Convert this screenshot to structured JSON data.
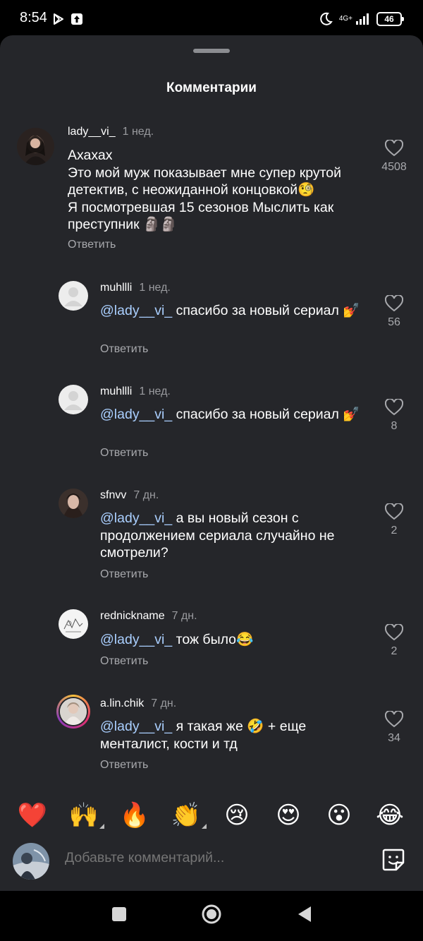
{
  "status_bar": {
    "time": "8:54",
    "network": "4G+",
    "battery": "46"
  },
  "sheet": {
    "title": "Комментарии"
  },
  "comments": [
    {
      "username": "lady__vi_",
      "time": "1 нед.",
      "mention": "",
      "text": "Ахахах\nЭто мой муж показывает мне супер крутой детектив, с неожиданной концовкой🧐\nЯ посмотревшая 15 сезонов Мыслить как преступник 🗿🗿",
      "reply": "Ответить",
      "likes": "4508"
    },
    {
      "username": "muhllli",
      "time": "1 нед.",
      "mention": "@lady__vi_",
      "text": " спасибо за новый сериал 💅",
      "reply": "Ответить",
      "likes": "56"
    },
    {
      "username": "muhllli",
      "time": "1 нед.",
      "mention": "@lady__vi_",
      "text": " спасибо за новый сериал 💅",
      "reply": "Ответить",
      "likes": "8"
    },
    {
      "username": "sfnvv",
      "time": "7 дн.",
      "mention": "@lady__vi_",
      "text": " а вы новый сезон с продолжением сериала случайно не смотрели?",
      "reply": "Ответить",
      "likes": "2"
    },
    {
      "username": "rednickname",
      "time": "7 дн.",
      "mention": "@lady__vi_",
      "text": " тож было😂",
      "reply": "Ответить",
      "likes": "2"
    },
    {
      "username": "a.lin.chik",
      "time": "7 дн.",
      "mention": "@lady__vi_",
      "text": " я такая же 🤣 + еще менталист, кости и тд",
      "reply": "Ответить",
      "likes": "34"
    }
  ],
  "emoji_bar": [
    "❤️",
    "🙌",
    "🔥",
    "👏",
    "😢",
    "😍",
    "😮",
    "😂"
  ],
  "input": {
    "placeholder": "Добавьте комментарий..."
  }
}
